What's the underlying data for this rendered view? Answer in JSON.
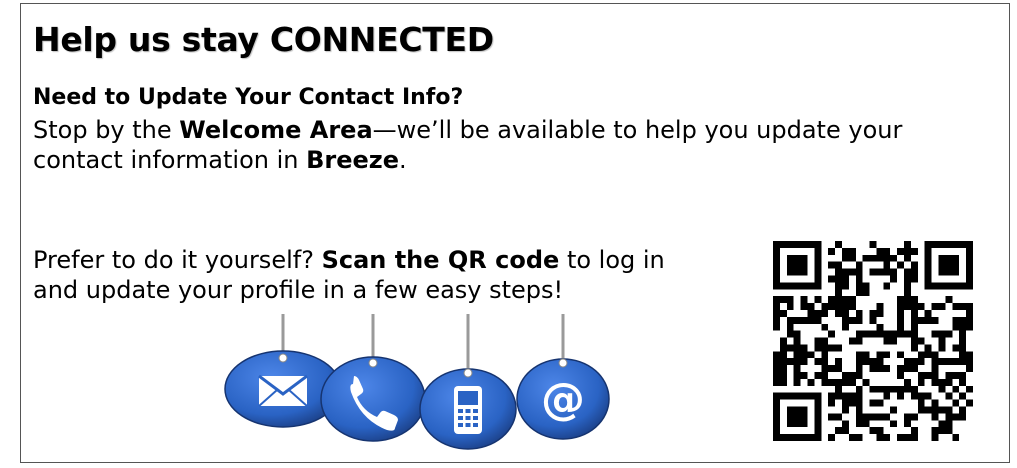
{
  "flyer": {
    "title": "Help us stay CONNECTED",
    "subhead": "Need to Update Your Contact Info?",
    "para1": {
      "t1": "Stop by the ",
      "b1": "Welcome Area",
      "t2": "—we’ll be available to help you update your contact information in ",
      "b2": "Breeze",
      "t3": "."
    },
    "para2": {
      "t1": "Prefer to do it yourself? ",
      "b1": "Scan the QR code",
      "t2": " to log in and update your profile in a few easy steps!"
    }
  },
  "contact_tags": [
    {
      "icon": "envelope-icon"
    },
    {
      "icon": "phone-handset-icon"
    },
    {
      "icon": "mobile-phone-icon"
    },
    {
      "icon": "at-sign-icon"
    }
  ],
  "at_symbol": "@",
  "qr_code": {
    "icon": "qr-code-icon"
  },
  "colors": {
    "tag_blue": "#2a63c4",
    "tag_blue_dark": "#1b3f86",
    "text": "#000000",
    "border": "#555555"
  }
}
